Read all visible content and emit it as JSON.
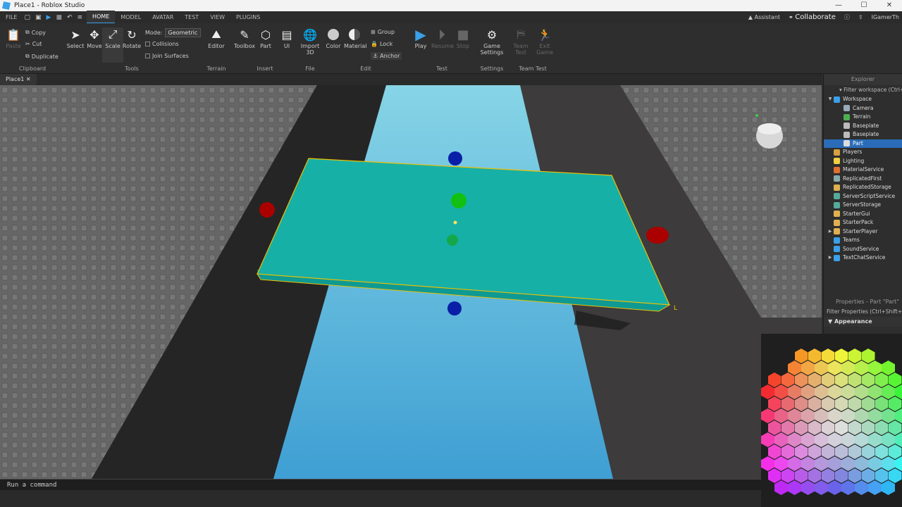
{
  "window": {
    "title": "Place1 - Roblox Studio",
    "controls": [
      "—",
      "☐",
      "✕"
    ]
  },
  "menu": {
    "file": "FILE",
    "tabs": [
      "HOME",
      "MODEL",
      "AVATAR",
      "TEST",
      "VIEW",
      "PLUGINS"
    ],
    "active_tab": "HOME",
    "assistant": "Assistant",
    "collaborate": "Collaborate",
    "user": "IGamerTh"
  },
  "ribbon": {
    "clipboard": {
      "paste": "Paste",
      "copy": "Copy",
      "cut": "Cut",
      "duplicate": "Duplicate",
      "label": "Clipboard"
    },
    "tools": {
      "select": "Select",
      "move": "Move",
      "scale": "Scale",
      "rotate": "Rotate",
      "mode_label": "Mode:",
      "mode_value": "Geometric",
      "collisions": "Collisions",
      "join_surfaces": "Join Surfaces",
      "label": "Tools"
    },
    "terrain": {
      "editor": "Editor",
      "label": "Terrain"
    },
    "insert": {
      "toolbox": "Toolbox",
      "part": "Part",
      "ui": "UI",
      "label": "Insert"
    },
    "file": {
      "import": "Import 3D",
      "label": "File"
    },
    "edit": {
      "color": "Color",
      "material": "Material",
      "group": "Group",
      "lock": "Lock",
      "anchor": "Anchor",
      "label": "Edit"
    },
    "test": {
      "play": "Play",
      "resume": "Resume",
      "stop": "Stop",
      "label": "Test"
    },
    "settings": {
      "game_settings": "Game Settings",
      "label": "Settings"
    },
    "team_test": {
      "team_test": "Team Test",
      "exit_game": "Exit Game",
      "label": "Team Test"
    }
  },
  "doc_tab": {
    "label": "Place1",
    "close": "✕"
  },
  "command_bar": {
    "placeholder": "Run a command"
  },
  "explorer": {
    "title": "Explorer",
    "filter": "Filter workspace (Ctrl+Shift+X)",
    "items": [
      {
        "label": "Workspace",
        "level": 0,
        "expander": "▼",
        "icon_color": "#3aa0e8"
      },
      {
        "label": "Camera",
        "level": 1,
        "expander": "",
        "icon_color": "#9ab"
      },
      {
        "label": "Terrain",
        "level": 1,
        "expander": "",
        "icon_color": "#4caf50"
      },
      {
        "label": "Baseplate",
        "level": 1,
        "expander": "",
        "icon_color": "#bbb"
      },
      {
        "label": "Baseplate",
        "level": 1,
        "expander": "",
        "icon_color": "#bbb"
      },
      {
        "label": "Part",
        "level": 1,
        "expander": "",
        "icon_color": "#ddd",
        "selected": true
      },
      {
        "label": "Players",
        "level": 0,
        "expander": "",
        "icon_color": "#d8a040"
      },
      {
        "label": "Lighting",
        "level": 0,
        "expander": "",
        "icon_color": "#f0d040"
      },
      {
        "label": "MaterialService",
        "level": 0,
        "expander": "",
        "icon_color": "#e07030"
      },
      {
        "label": "ReplicatedFirst",
        "level": 0,
        "expander": "",
        "icon_color": "#8aa"
      },
      {
        "label": "ReplicatedStorage",
        "level": 0,
        "expander": "",
        "icon_color": "#e0b050"
      },
      {
        "label": "ServerScriptService",
        "level": 0,
        "expander": "",
        "icon_color": "#5a9"
      },
      {
        "label": "ServerStorage",
        "level": 0,
        "expander": "",
        "icon_color": "#5a9"
      },
      {
        "label": "StarterGui",
        "level": 0,
        "expander": "",
        "icon_color": "#e0b050"
      },
      {
        "label": "StarterPack",
        "level": 0,
        "expander": "",
        "icon_color": "#e0b050"
      },
      {
        "label": "StarterPlayer",
        "level": 0,
        "expander": "▶",
        "icon_color": "#e0b050"
      },
      {
        "label": "Teams",
        "level": 0,
        "expander": "",
        "icon_color": "#3aa0e8"
      },
      {
        "label": "SoundService",
        "level": 0,
        "expander": "",
        "icon_color": "#3aa0e8"
      },
      {
        "label": "TextChatService",
        "level": 0,
        "expander": "▶",
        "icon_color": "#3aa0e8"
      }
    ]
  },
  "properties": {
    "title": "Properties - Part \"Part\"",
    "filter": "Filter Properties (Ctrl+Shift+P)",
    "section": "Appearance"
  },
  "viewport": {
    "part_color": "#17b0a6",
    "water_color": "#5ec4dc",
    "baseplate_color": "#5c5c5c"
  }
}
